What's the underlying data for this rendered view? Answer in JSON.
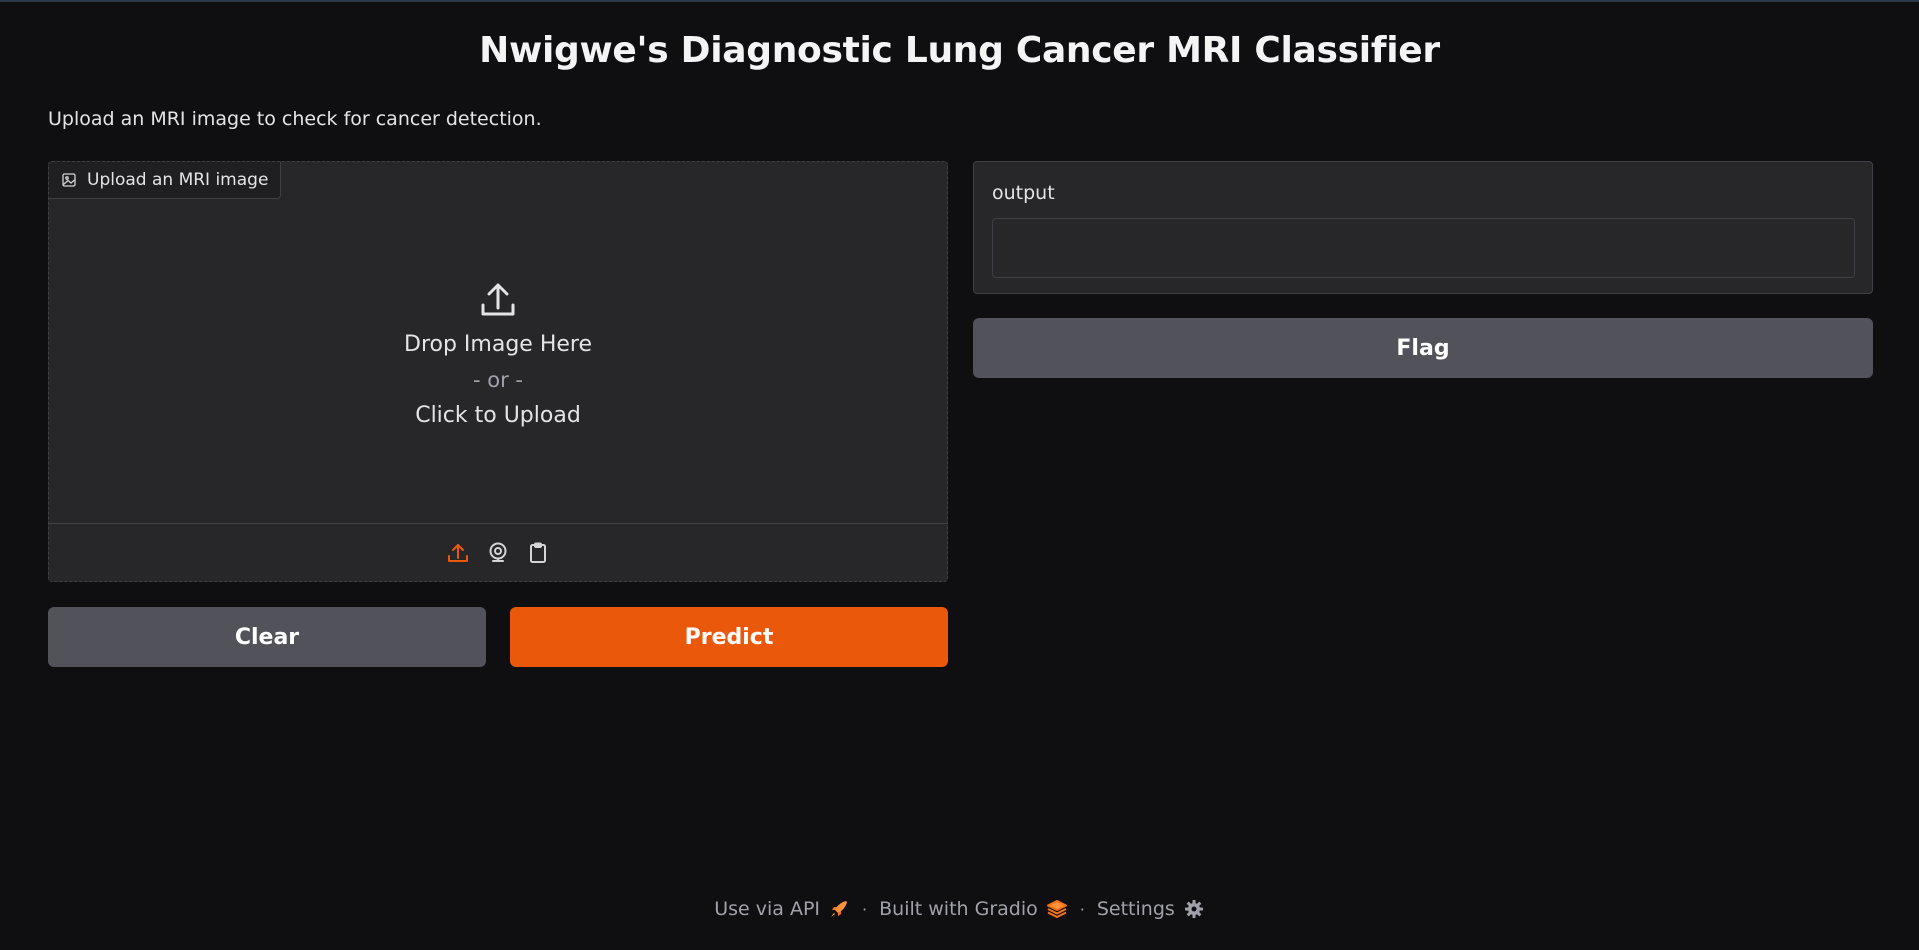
{
  "header": {
    "title": "Nwigwe's Diagnostic Lung Cancer MRI Classifier",
    "description": "Upload an MRI image to check for cancer detection."
  },
  "upload": {
    "label": "Upload an MRI image",
    "drop_text": "Drop Image Here",
    "or_text": "- or -",
    "click_text": "Click to Upload",
    "sources": [
      "upload-icon",
      "webcam-icon",
      "clipboard-icon"
    ]
  },
  "buttons": {
    "clear": "Clear",
    "predict": "Predict",
    "flag": "Flag"
  },
  "output": {
    "label": "output",
    "value": ""
  },
  "footer": {
    "api": "Use via API",
    "separator": "·",
    "built": "Built with Gradio",
    "settings": "Settings"
  },
  "colors": {
    "accent": "#ea580c",
    "background": "#0f0f11",
    "panel": "#27272a",
    "secondary_button": "#52525b"
  }
}
